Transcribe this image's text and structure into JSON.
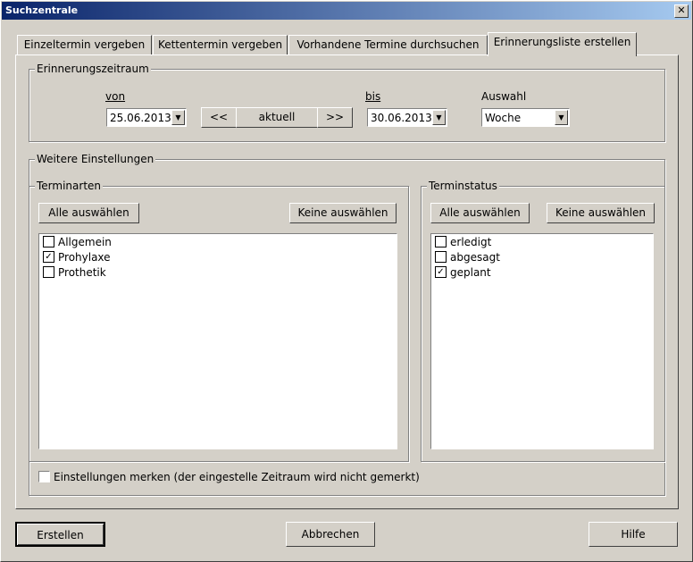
{
  "window": {
    "title": "Suchzentrale",
    "close_label": "✕"
  },
  "tabs": [
    {
      "label": "Einzeltermin vergeben"
    },
    {
      "label": "Kettentermin vergeben"
    },
    {
      "label": "Vorhandene Termine durchsuchen"
    },
    {
      "label": "Erinnerungsliste erstellen"
    }
  ],
  "zeitraum": {
    "legend": "Erinnerungszeitraum",
    "von_label": "von",
    "von_value": "25.06.2013",
    "prev_label": "<<",
    "current_label": "aktuell",
    "next_label": ">>",
    "bis_label": "bis",
    "bis_value": "30.06.2013",
    "auswahl_label": "Auswahl",
    "auswahl_value": "Woche"
  },
  "settings": {
    "legend": "Weitere Einstellungen",
    "terminarten": {
      "legend": "Terminarten",
      "select_all": "Alle auswählen",
      "select_none": "Keine auswählen",
      "items": [
        {
          "label": "Allgemein",
          "checked": false
        },
        {
          "label": "Prohylaxe",
          "checked": true
        },
        {
          "label": "Prothetik",
          "checked": false
        }
      ]
    },
    "terminstatus": {
      "legend": "Terminstatus",
      "select_all": "Alle auswählen",
      "select_none": "Keine auswählen",
      "items": [
        {
          "label": "erledigt",
          "checked": false
        },
        {
          "label": "abgesagt",
          "checked": false
        },
        {
          "label": "geplant",
          "checked": true
        }
      ]
    },
    "remember_label": "Einstellungen merken (der eingestelle Zeitraum wird nicht gemerkt)",
    "remember_checked": false
  },
  "footer": {
    "create_label": "Erstellen",
    "cancel_label": "Abbrechen",
    "help_label": "Hilfe"
  }
}
